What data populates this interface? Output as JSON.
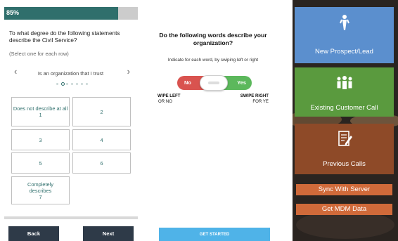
{
  "survey": {
    "progress_label": "85%",
    "progress_value": 0.85,
    "question": "To what degree do the following statements describe the Civil Service?",
    "hint": "(Select one for each row)",
    "statement": "Is an organization that I trust",
    "statement_total": 7,
    "statement_active": 1,
    "options": [
      {
        "text": "Does not describe at all",
        "value": "1"
      },
      {
        "text": "",
        "value": "2"
      },
      {
        "text": "",
        "value": "3"
      },
      {
        "text": "",
        "value": "4"
      },
      {
        "text": "",
        "value": "5"
      },
      {
        "text": "",
        "value": "6"
      },
      {
        "text": "Completely describes",
        "value": "7"
      }
    ],
    "back_label": "Back",
    "next_label": "Next"
  },
  "swipe": {
    "title": "Do the following words describe your organization?",
    "instruction": "Indicate for each word, by swiping left or right",
    "no_label": "No",
    "yes_label": "Yes",
    "swipe_left": "WIPE LEFT",
    "or_no": "OR NO",
    "swipe_right": "SWIPE RIGHT",
    "for_yes": "FOR YE",
    "get_started": "GET STARTED"
  },
  "menu": {
    "tiles": [
      {
        "label": "New Prospect/Lead",
        "icon": "person-icon",
        "color": "#5b8fce"
      },
      {
        "label": "Existing Customer Call",
        "icon": "group-icon",
        "color": "#5a9a3e"
      },
      {
        "label": "Previous Calls",
        "icon": "note-edit-icon",
        "color": "#8e4a28"
      }
    ],
    "sync_label": "Sync With Server",
    "mdm_label": "Get MDM Data",
    "strip_color": "#d06a3a"
  },
  "colors": {
    "teal": "#2f6f6c",
    "navy": "#2e3a48",
    "no_red": "#d9534f",
    "yes_green": "#5cb85c",
    "sky_blue": "#4fb3e8"
  }
}
